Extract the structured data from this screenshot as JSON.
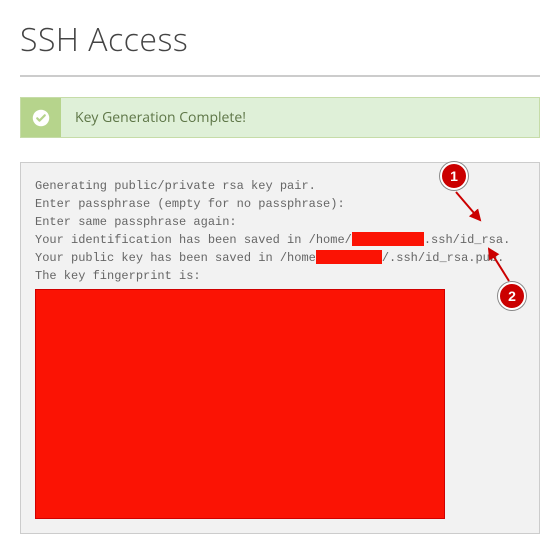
{
  "header": {
    "title": "SSH Access"
  },
  "alert": {
    "message": "Key Generation Complete!"
  },
  "terminal": {
    "lines": {
      "l1": "Generating public/private rsa key pair.",
      "l2": "Enter passphrase (empty for no passphrase):",
      "l3": "Enter same passphrase again:",
      "l4a": "Your identification has been saved in /home/",
      "l4b": ".ssh/id_rsa.",
      "l5a": "Your public key has been saved in /home",
      "l5b": "/.ssh/id_rsa.pub.",
      "l6": "The key fingerprint is:"
    }
  },
  "annotations": {
    "one": "1",
    "two": "2"
  }
}
